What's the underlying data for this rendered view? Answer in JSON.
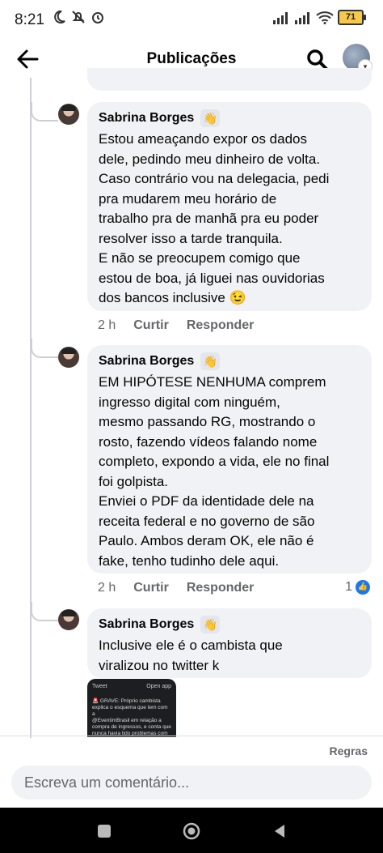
{
  "status_bar": {
    "time": "8:21",
    "battery": "71"
  },
  "header": {
    "title": "Publicações"
  },
  "comments": [
    {
      "author": "Sabrina Borges",
      "badge": "👋",
      "text": "Estou ameaçando expor os dados\ndele, pedindo meu dinheiro de volta.\nCaso contrário vou na delegacia, pedi\npra mudarem meu horário de\ntrabalho pra de manhã pra eu poder\nresolver isso a tarde tranquila.\nE não se preocupem comigo que\nestou de boa, já liguei nas ouvidorias\ndos bancos inclusive 😉",
      "time": "2 h",
      "reply_label": "Curtir",
      "respond_label": "Responder"
    },
    {
      "author": "Sabrina Borges",
      "badge": "👋",
      "text": "EM HIPÓTESE NENHUMA comprem\ningresso digital com ninguém,\nmesmo passando RG, mostrando o\nrosto, fazendo vídeos falando nome\ncompleto, expondo a vida, ele no final\nfoi golpista.\nEnviei o PDF da identidade dele na\nreceita federal e no governo de são\nPaulo. Ambos deram OK, ele não é\nfake, tenho tudinho dele aqui.",
      "time": "2 h",
      "reply_label": "Curtir",
      "respond_label": "Responder",
      "reactions": "1"
    },
    {
      "author": "Sabrina Borges",
      "badge": "👋",
      "text": "Inclusive ele é o cambista que\nviralizou no twitter k"
    }
  ],
  "attachment": {
    "header_left": "Tweet",
    "header_right": "Open app",
    "body": "🚨 GRAVE: Próprio cambista\nexplica o esquema que tem com a\n@EventimBrasil em relação a\ncompra de ingressos, e conta que\nnunca havia tido problemas com"
  },
  "footer": {
    "rules_label": "Regras",
    "comment_placeholder": "Escreva um comentário..."
  }
}
